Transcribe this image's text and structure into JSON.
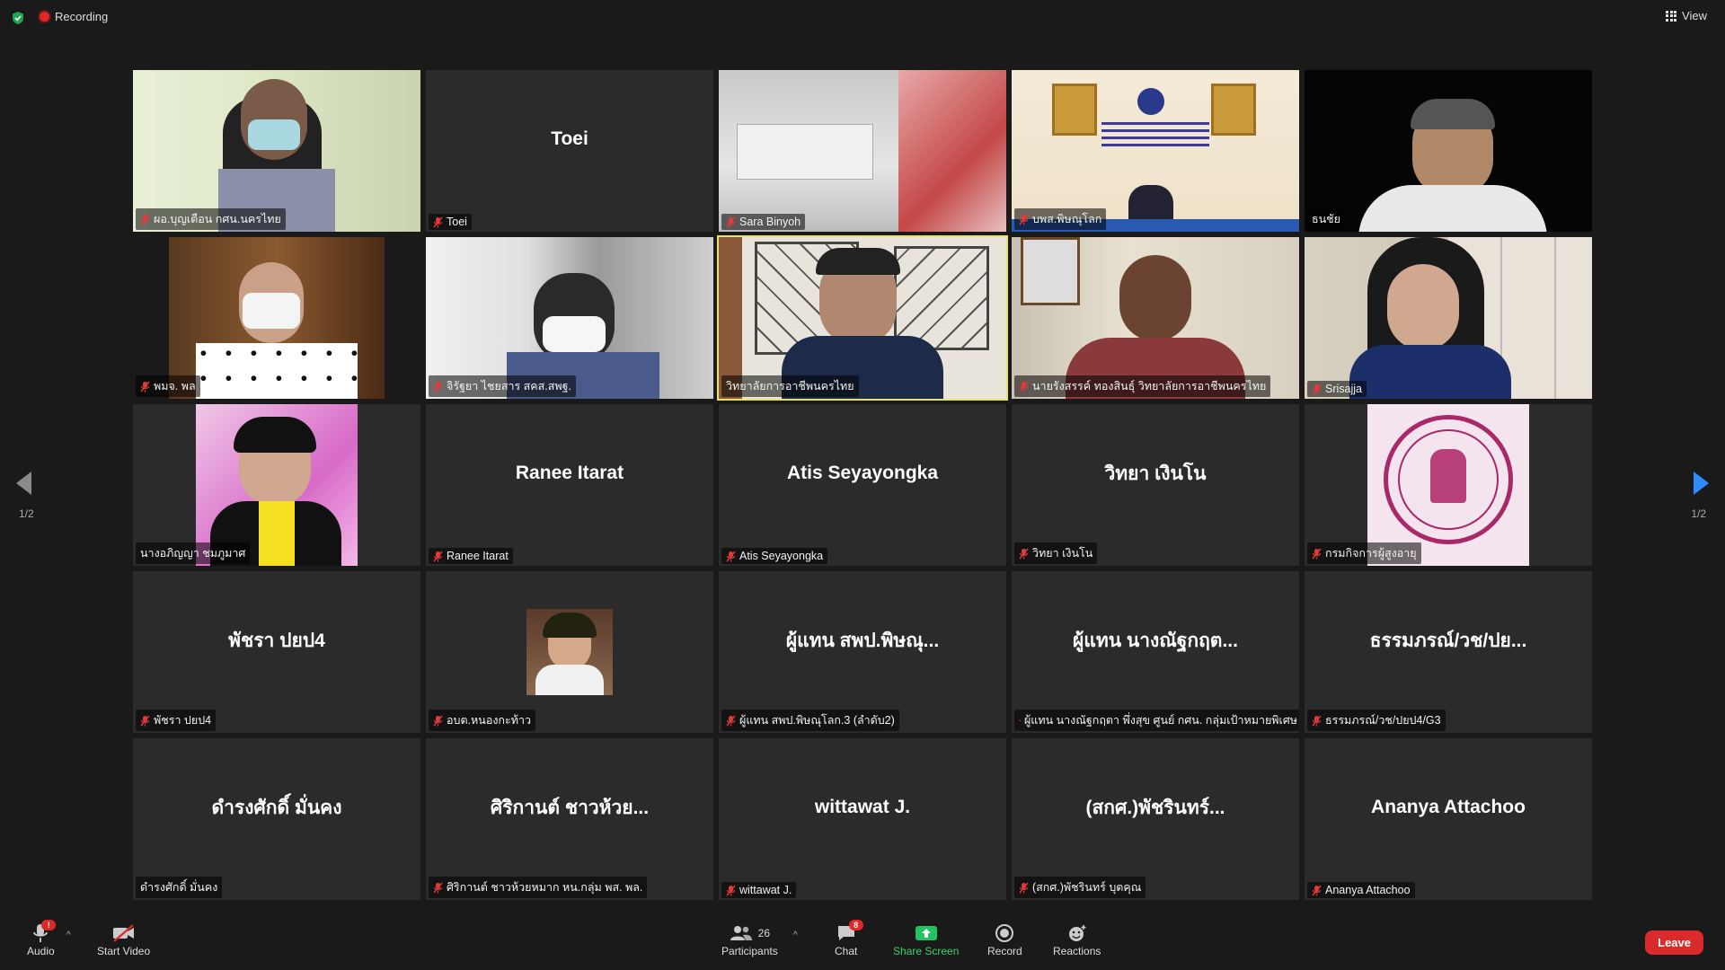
{
  "topbar": {
    "recording_label": "Recording",
    "view_label": "View"
  },
  "pagination": {
    "left": "1/2",
    "right": "1/2"
  },
  "tiles": [
    {
      "big": "",
      "tag": "ผอ.บุญเตือน กศน.นครไทย",
      "muted": true,
      "video": "v1"
    },
    {
      "big": "Toei",
      "tag": "Toei",
      "muted": true,
      "video": ""
    },
    {
      "big": "",
      "tag": "Sara Binyoh",
      "muted": true,
      "video": "v3"
    },
    {
      "big": "",
      "tag": "บพส.พิษณุโลก",
      "muted": true,
      "video": "v4"
    },
    {
      "big": "",
      "tag": "ธนชัย",
      "muted": false,
      "video": "v5"
    },
    {
      "big": "",
      "tag": "พมจ. พล",
      "muted": true,
      "video": "v6"
    },
    {
      "big": "",
      "tag": "จิรัฐยา ไชยสาร สคส.สพฐ.",
      "muted": true,
      "video": "v7"
    },
    {
      "big": "",
      "tag": "วิทยาลัยการอาชีพนครไทย",
      "muted": false,
      "video": "v8",
      "active": true
    },
    {
      "big": "",
      "tag": "นายรังสรรค์ ทองสินธุ์ วิทยาลัยการอาชีพนครไทย",
      "muted": true,
      "video": "v9"
    },
    {
      "big": "",
      "tag": "Srisajja",
      "muted": true,
      "video": "v10"
    },
    {
      "big": "",
      "tag": "นางอภิญญา ชมภูมาศ",
      "muted": false,
      "video": "v11"
    },
    {
      "big": "Ranee Itarat",
      "tag": "Ranee Itarat",
      "muted": true,
      "video": ""
    },
    {
      "big": "Atis Seyayongka",
      "tag": "Atis Seyayongka",
      "muted": true,
      "video": ""
    },
    {
      "big": "วิทยา เงินโน",
      "tag": "วิทยา เงินโน",
      "muted": true,
      "video": ""
    },
    {
      "big": "",
      "tag": "กรมกิจการผู้สูงอายุ",
      "muted": true,
      "video": "v15"
    },
    {
      "big": "พัชรา ปยป4",
      "tag": "พัชรา ปยป4",
      "muted": true,
      "video": ""
    },
    {
      "big": "",
      "tag": "อบต.หนองกะท้าว",
      "muted": true,
      "video": "v17"
    },
    {
      "big": "ผู้แทน สพป.พิษณุ...",
      "tag": "ผู้แทน สพป.พิษณุโลก.3 (ลำดับ2)",
      "muted": true,
      "video": ""
    },
    {
      "big": "ผู้แทน นางณัฐกฤต...",
      "tag": "ผู้แทน นางณัฐกฤตา พึ่งสุข  ศูนย์ กศน. กลุ่มเป้าหมายพิเศษ",
      "muted": true,
      "video": ""
    },
    {
      "big": "ธรรมภรณ์/วช/ปย...",
      "tag": "ธรรมภรณ์/วช/ปยป4/G3",
      "muted": true,
      "video": ""
    },
    {
      "big": "ดำรงศักดิ์  มั่นคง",
      "tag": "ดำรงศักดิ์  มั่นคง",
      "muted": false,
      "video": ""
    },
    {
      "big": "ศิริกานต์ ชาวห้วย...",
      "tag": "ศิริกานต์ ชาวห้วยหมาก หน.กลุ่ม พส. พล.",
      "muted": true,
      "video": ""
    },
    {
      "big": "wittawat J.",
      "tag": "wittawat J.",
      "muted": true,
      "video": ""
    },
    {
      "big": "(สกศ.)พัชรินทร์...",
      "tag": "(สกศ.)พัชรินทร์  บุตคุณ",
      "muted": true,
      "video": ""
    },
    {
      "big": "Ananya Attachoo",
      "tag": "Ananya Attachoo",
      "muted": true,
      "video": ""
    }
  ],
  "toolbar": {
    "audio_label": "Audio",
    "audio_badge": "!",
    "video_label": "Start Video",
    "participants_label": "Participants",
    "participants_count": "26",
    "chat_label": "Chat",
    "chat_badge": "8",
    "share_label": "Share Screen",
    "record_label": "Record",
    "reactions_label": "Reactions",
    "leave_label": "Leave"
  },
  "colors": {
    "accent_blue": "#2d8cff",
    "leave_red": "#d92b2b",
    "active_speaker": "#e6e26a",
    "share_green": "#3dd16b"
  }
}
